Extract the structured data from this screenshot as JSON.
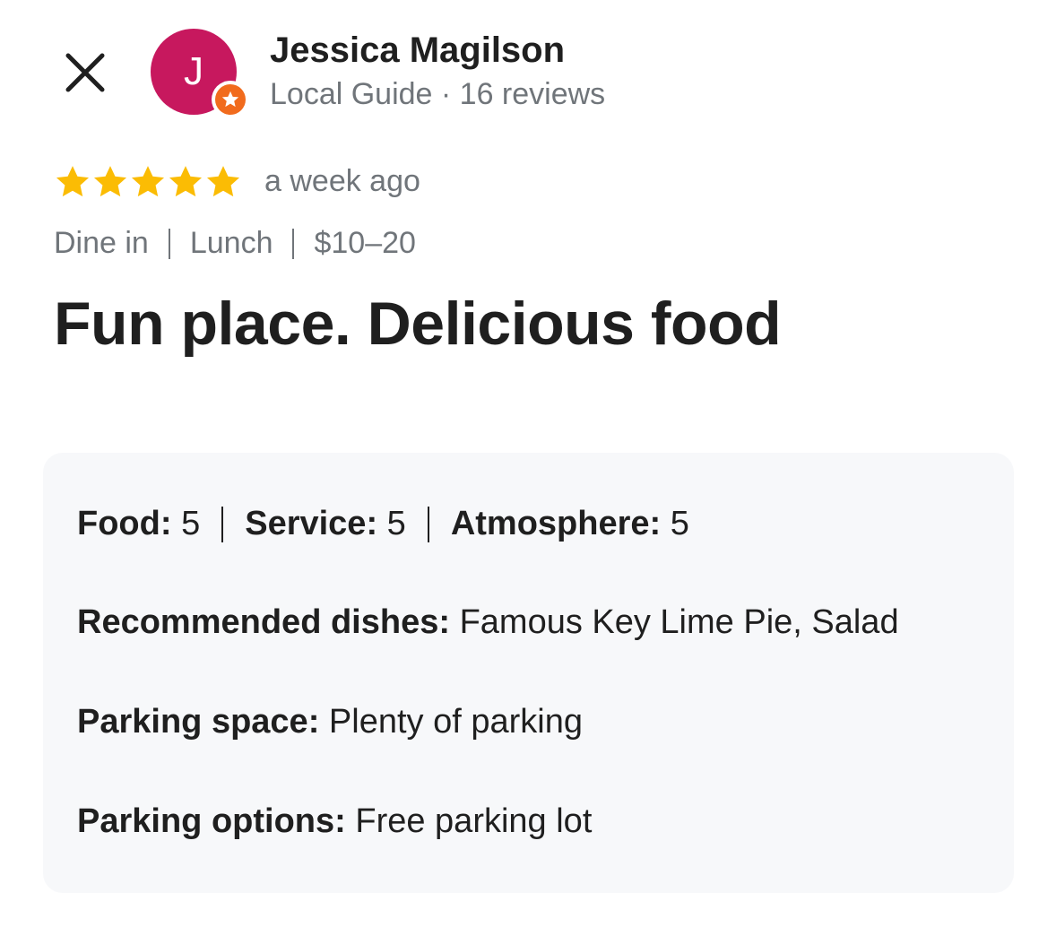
{
  "colors": {
    "avatar_bg": "#c7185e",
    "badge_bg": "#f16b1d",
    "star": "#fbbc04"
  },
  "header": {
    "close_icon": "close-icon",
    "avatar_initial": "J",
    "user_name": "Jessica Magilson",
    "user_meta": "Local Guide · 16 reviews",
    "badge_icon": "star-badge-icon"
  },
  "review": {
    "rating": 5,
    "rating_max": 5,
    "time_ago": "a week ago",
    "tags": [
      "Dine in",
      "Lunch",
      "$10–20"
    ],
    "headline": "Fun place. Delicious food"
  },
  "details": {
    "scores": [
      {
        "label": "Food:",
        "value": "5"
      },
      {
        "label": "Service:",
        "value": "5"
      },
      {
        "label": "Atmosphere:",
        "value": "5"
      }
    ],
    "recommended_label": "Recommended dishes:",
    "recommended_value": "Famous Key Lime Pie, Salad",
    "parking_space_label": "Parking space:",
    "parking_space_value": "Plenty of parking",
    "parking_options_label": "Parking options:",
    "parking_options_value": "Free parking lot"
  }
}
